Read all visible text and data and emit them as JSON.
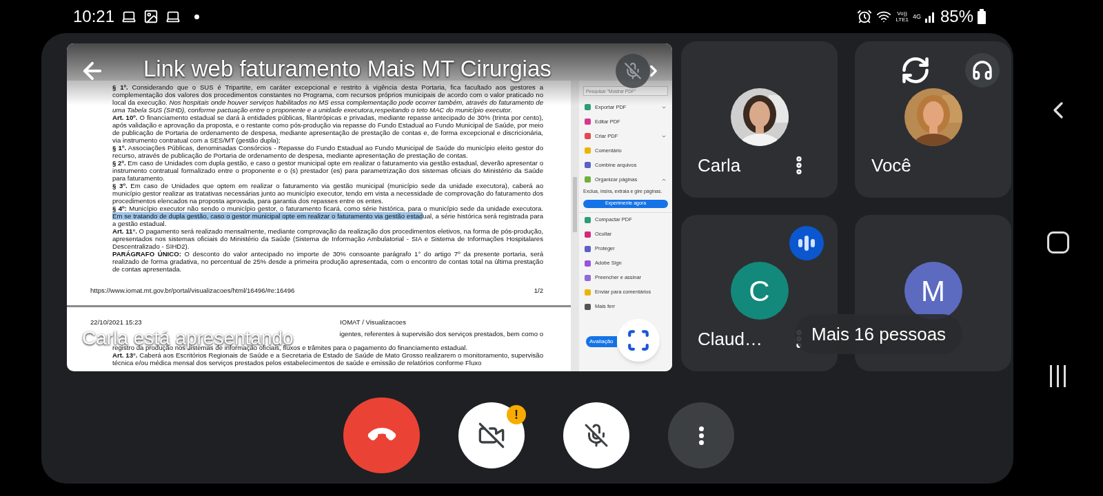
{
  "status_bar": {
    "time": "10:21",
    "volte": "Vo))",
    "lte": "LTE1",
    "network": "4G",
    "battery": "85%"
  },
  "presentation": {
    "title": "Link web faturamento Mais MT Cirurgias",
    "presenter_label": "Carla está apresentando",
    "document": {
      "page_1_paragraphs": [
        {
          "segments": [
            {
              "text": "**§ 1º.** Considerando que o SUS é Tripartite, em caráter excepcional e restrito à vigência desta Portaria, fica facultado aos gestores a complementação dos valores dos procedimentos constantes no Programa, com recursos próprios municipais de acordo com o valor praticado no local da execução. *Nos hospitais onde houver serviços habilitados no MS essa complementação pode ocorrer também, através do faturamento de uma Tabela SUS (SIHD), conforme pactuação entre o proponente e a unidade executora,respeitando o teto MAC do município executor.*",
              "highlighted": false
            }
          ]
        },
        {
          "segments": [
            {
              "text": "**Art. 10º.** O financiamento estadual se dará à entidades públicas, filantrópicas e privadas, mediante repasse antecipado de 30% (trinta por cento), após validação e aprovação da proposta, e o restante como pós-produção via repasse do Fundo Estadual ao Fundo Municipal de Saúde, por meio de publicação de Portaria de ordenamento de despesa, mediante apresentação de prestação de contas e, de forma excepcional e discricionária, via instrumento contratual com a SES/MT (gestão dupla);",
              "highlighted": false
            }
          ]
        },
        {
          "segments": [
            {
              "text": "**§ 1º.** Associações Públicas, denominadas Consórcios - Repasse do Fundo Estadual ao Fundo Municipal de Saúde do município eleito gestor do recurso, através de publicação de Portaria de ordenamento de despesa, mediante apresentação de prestação de contas.",
              "highlighted": false
            }
          ]
        },
        {
          "segments": [
            {
              "text": "**§ 2º.** Em caso de Unidades com dupla gestão, e caso o gestor municipal opte em realizar o faturamento via gestão estadual, deverão apresentar o instrumento contratual formalizado entre o proponente e o (s) prestador (es) para parametrização dos sistemas oficiais do Ministério da Saúde para faturamento.",
              "highlighted": false
            }
          ]
        },
        {
          "segments": [
            {
              "text": "**§ 3º.** Em caso de Unidades que optem em realizar o faturamento via gestão municipal (município sede da unidade executora), caberá ao município gestor realizar as tratativas necessárias junto ao município executor, tendo em vista a necessidade de comprovação do faturamento dos procedimentos elencados na proposta aprovada, para garantia dos repasses entre os entes.",
              "highlighted": false
            }
          ]
        },
        {
          "segments": [
            {
              "text": "**§ 4º:** Município executor não sendo o município gestor, o faturamento ficará, como série histórica, para o município sede da unidade executora. ",
              "highlighted": false
            },
            {
              "text": "Em se tratando de dupla gestão, caso o gestor municipal opte em realizar o faturamento via gestão estad",
              "highlighted": true
            },
            {
              "text": "ual, a série histórica será registrada para a gestão estadual.",
              "highlighted": false
            }
          ]
        },
        {
          "segments": [
            {
              "text": "**Art. 11°.** O pagamento será realizado mensalmente, mediante comprovação da realização dos procedimentos eletivos, na forma de pós-produção, apresentados nos sistemas oficiais do Ministério da Saúde (Sistema de Informação Ambulatorial - SIA e Sistema de Informações Hospitalares Descentralizado - SIHD2).",
              "highlighted": false
            }
          ]
        },
        {
          "segments": [
            {
              "text": "**PARÁGRAFO ÚNICO:** O desconto do valor antecipado no importe de 30% consoante parágrafo 1° do artigo 7º da presente portaria, será realizado de forma gradativa, no percentual de 25% desde a primeira produção apresentada, com o encontro de contas total na última prestação de contas apresentada.",
              "highlighted": false
            }
          ]
        }
      ],
      "footer_url": "https://www.iomat.mt.gov.br/portal/visualizacoes/html/16496/#e:16496",
      "page_number": "1/2",
      "page_2_date": "22/10/2021 15:23",
      "page_2_header": "IOMAT / Visualizacoes",
      "page_2_paragraphs": [
        {
          "segments": [
            {
              "text": "igentes, referentes à supervisão dos serviços prestados, bem como o",
              "highlighted": false
            }
          ]
        },
        {
          "segments": [
            {
              "text": "registro da produção nos sistemas de informação oficiais, fluxos e trâmites para o pagamento do financiamento estadual.",
              "highlighted": false
            }
          ]
        },
        {
          "segments": [
            {
              "text": "**Art. 13°.** Caberá aos Escritórios Regionais de Saúde e a Secretaria de Estado de Saúde de Mato Grosso realizarem o monitoramento, supervisão técnica e/ou médica mensal dos serviços prestados pelos estabelecimentos de saúde e emissão de relatórios conforme Fluxo",
              "highlighted": false
            }
          ]
        }
      ]
    },
    "tools_panel": {
      "search_placeholder": "Pesquisar \"Mostrar PDF\"",
      "tools": [
        {
          "label": "Exportar PDF",
          "color": "#2d9d78",
          "kind": "menu",
          "expanded": false
        },
        {
          "label": "Editar PDF",
          "color": "#d83790",
          "kind": "plain"
        },
        {
          "label": "Criar PDF",
          "color": "#e34850",
          "kind": "menu",
          "expanded": false
        },
        {
          "label": "Comentário",
          "color": "#e8b600",
          "kind": "plain"
        },
        {
          "label": "Combine arquivos",
          "color": "#5b5fc7",
          "kind": "plain"
        },
        {
          "label": "Organizar páginas",
          "color": "#6fb13a",
          "kind": "menu",
          "expanded": true,
          "hint": "Exclua, insira, extraia e gire páginas.",
          "action": "Experimente agora"
        },
        {
          "label": "Compactar PDF",
          "color": "#2d9d78",
          "kind": "plain"
        },
        {
          "label": "Ocultar",
          "color": "#d6277a",
          "kind": "plain"
        },
        {
          "label": "Proteger",
          "color": "#5b5fc7",
          "kind": "plain"
        },
        {
          "label": "Adobe Sign",
          "color": "#9b51e0",
          "kind": "plain"
        },
        {
          "label": "Preencher e assinar",
          "color": "#8e6bd8",
          "kind": "plain"
        },
        {
          "label": "Enviar para comentários",
          "color": "#e8b600",
          "kind": "plain"
        },
        {
          "label": "Mais ferr",
          "color": "#555555",
          "kind": "plain"
        }
      ],
      "trial_button": "Avaliação"
    }
  },
  "participants": [
    {
      "name": "Carla",
      "menu": true,
      "speaking": false
    },
    {
      "name": "Você",
      "menu": false,
      "speaking": false
    },
    {
      "name": "Claud…",
      "avatar": {
        "kind": "letter",
        "letter": "C",
        "color": "#12897b"
      },
      "menu": true,
      "speaking": true
    },
    {
      "avatar": {
        "kind": "letter",
        "letter": "M",
        "color": "#5c6bc0"
      },
      "menu": false,
      "speaking": false
    }
  ],
  "more_people": "Mais 16 pessoas",
  "controls": [
    {
      "kind": "end_call"
    },
    {
      "kind": "camera",
      "off": true,
      "warning": "!"
    },
    {
      "kind": "mic",
      "off": true
    },
    {
      "kind": "more"
    }
  ]
}
